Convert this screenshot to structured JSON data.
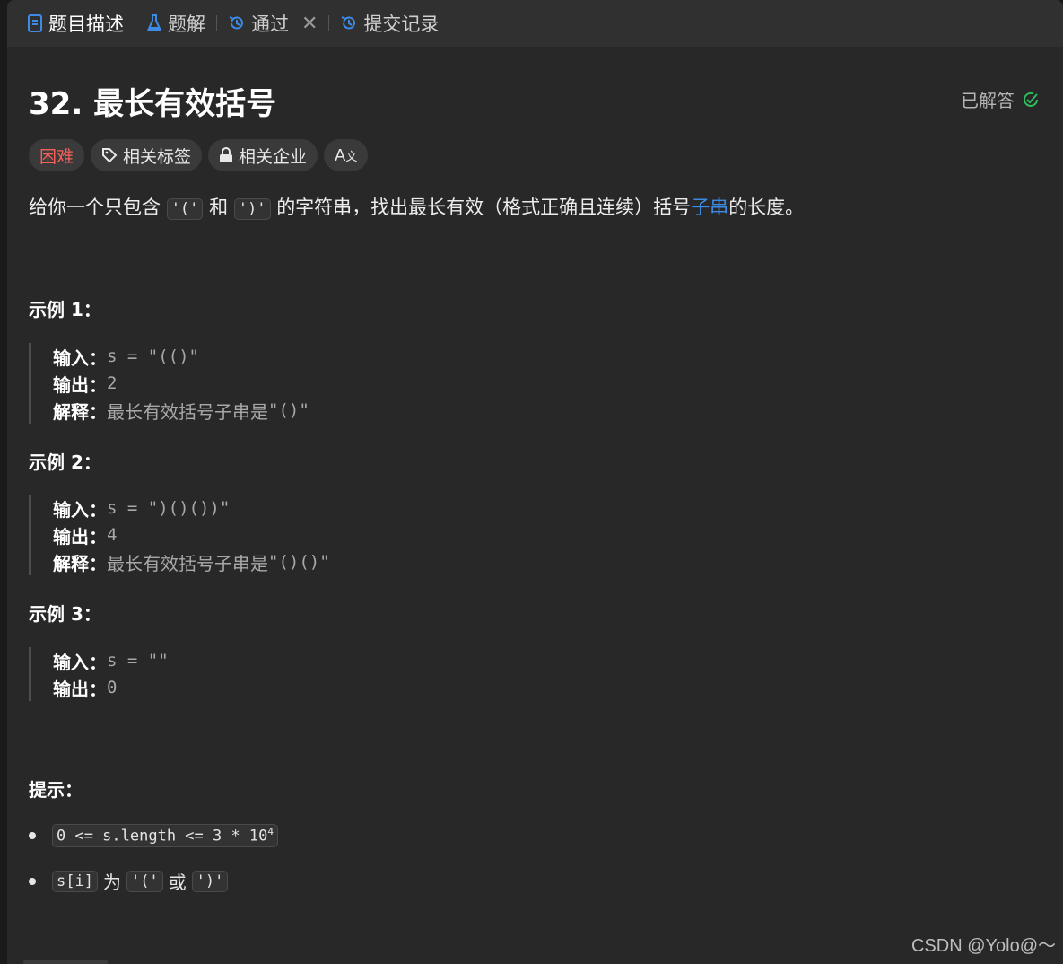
{
  "tabs": [
    {
      "label": "题目描述",
      "icon": "document-icon",
      "active": true
    },
    {
      "label": "题解",
      "icon": "flask-icon"
    },
    {
      "label": "通过",
      "icon": "history-icon"
    },
    {
      "label": "提交记录",
      "icon": "history-icon"
    }
  ],
  "problem": {
    "title": "32. 最长有效括号",
    "solved_label": "已解答",
    "tags": {
      "difficulty": "困难",
      "topics": "相关标签",
      "companies": "相关企业",
      "translate": "A"
    },
    "description": {
      "p1": "给你一个只包含",
      "c1": "'('",
      "p2": "和",
      "c2": "')'",
      "p3": "的字符串，找出最长有效（格式正确且连续）括号",
      "link": "子串",
      "p4": "的长度。"
    },
    "examples": [
      {
        "title": "示例 1：",
        "input_label": "输入：",
        "input": "s = \"(()\"",
        "output_label": "输出：",
        "output": "2",
        "explain_label": "解释：",
        "explain_text": "最长有效括号子串是 ",
        "explain_code": "\"()\""
      },
      {
        "title": "示例 2：",
        "input_label": "输入：",
        "input": "s = \")()())\"",
        "output_label": "输出：",
        "output": "4",
        "explain_label": "解释：",
        "explain_text": "最长有效括号子串是 ",
        "explain_code": "\"()()\""
      },
      {
        "title": "示例 3：",
        "input_label": "输入：",
        "input": "s = \"\"",
        "output_label": "输出：",
        "output": "0"
      }
    ],
    "hints_title": "提示：",
    "hint1": {
      "code": "0 <= s.length <= 3 * 10",
      "exp": "4"
    },
    "hint2": {
      "c1": "s[i]",
      "t1": "为",
      "c2": "'('",
      "t2": "或",
      "c3": "')'"
    }
  },
  "watermark": "CSDN @Yolo@～",
  "colors": {
    "accent": "#3c8ce7",
    "hard": "#f8615c",
    "solved": "#2cbb5d"
  }
}
